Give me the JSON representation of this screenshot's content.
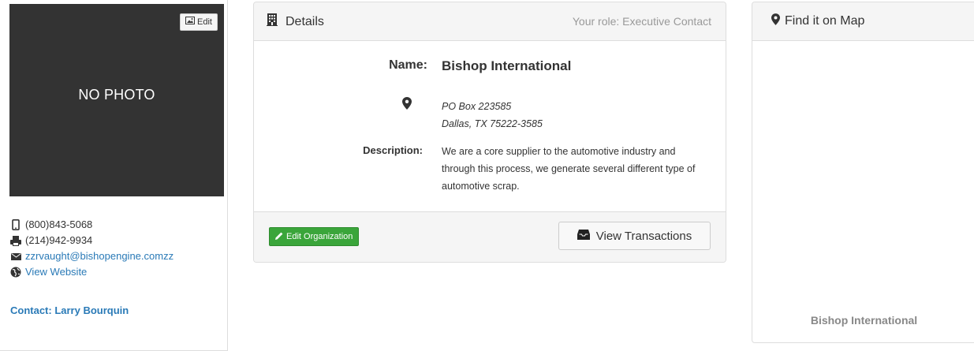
{
  "photo": {
    "edit_label": "Edit",
    "placeholder": "NO PHOTO"
  },
  "contact": {
    "phone": "(800)843-5068",
    "fax": "(214)942-9934",
    "email": "zzrvaught@bishopengine.comzz",
    "website_label": "View Website",
    "contact_label": "Contact: Larry Bourquin"
  },
  "details": {
    "title": "Details",
    "role": "Your role: Executive Contact",
    "name_label": "Name:",
    "name": "Bishop International",
    "address_line1": "PO Box 223585",
    "address_line2": "Dallas, TX 75222-3585",
    "description_label": "Description:",
    "description": "We are a core supplier to the automotive industry and through this process, we generate several different type of automotive scrap.",
    "edit_button": "Edit Organization",
    "transactions_button": "View Transactions"
  },
  "map": {
    "title": "Find it on Map",
    "label": "Bishop International"
  },
  "colors": {
    "link": "#2a7ab7",
    "success": "#3aa53a",
    "photo_bg": "#333333"
  }
}
